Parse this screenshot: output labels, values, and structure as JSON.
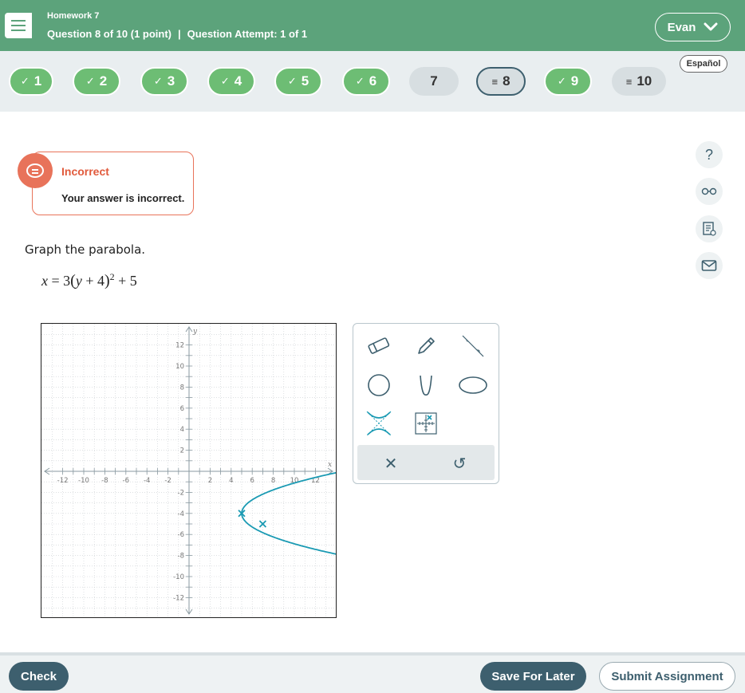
{
  "header": {
    "homework_title": "Homework 7",
    "question_label": "Question 8 of 10 (1 point)",
    "separator": "|",
    "attempt_label": "Question Attempt: 1 of 1",
    "user_name": "Evan",
    "language_link": "Español"
  },
  "question_nav": [
    {
      "number": "1",
      "status": "correct"
    },
    {
      "number": "2",
      "status": "correct"
    },
    {
      "number": "3",
      "status": "correct"
    },
    {
      "number": "4",
      "status": "correct"
    },
    {
      "number": "5",
      "status": "correct"
    },
    {
      "number": "6",
      "status": "correct"
    },
    {
      "number": "7",
      "status": "unanswered"
    },
    {
      "number": "8",
      "status": "partial-current"
    },
    {
      "number": "9",
      "status": "correct"
    },
    {
      "number": "10",
      "status": "partial"
    }
  ],
  "feedback": {
    "title": "Incorrect",
    "message": "Your answer is incorrect."
  },
  "question": {
    "prompt": "Graph the parabola."
  },
  "graph": {
    "x_label": "x",
    "y_label": "y",
    "x_ticks": [
      "-12",
      "-10",
      "-8",
      "-6",
      "-4",
      "-2",
      "2",
      "4",
      "6",
      "8",
      "10",
      "12"
    ],
    "y_ticks": [
      "12",
      "10",
      "8",
      "6",
      "4",
      "2",
      "-2",
      "-4",
      "-6",
      "-8",
      "-10",
      "-12"
    ],
    "range": [
      -13,
      13
    ],
    "curve": {
      "type": "parabola-horizontal",
      "a": 3,
      "k": -4,
      "h": 5
    },
    "points": [
      {
        "x": 5,
        "y": -4
      },
      {
        "x": 7,
        "y": -5
      }
    ],
    "curve_color": "#1a9ab3"
  },
  "tools": {
    "icons": [
      "eraser-icon",
      "pencil-icon",
      "line-icon",
      "circle-icon",
      "parabola-icon",
      "ellipse-icon",
      "hyperbola-icon",
      "point-grid-icon"
    ],
    "clear_glyph": "✕",
    "undo_glyph": "↺"
  },
  "footer": {
    "check_label": "Check",
    "save_label": "Save For Later",
    "submit_label": "Submit Assignment"
  },
  "colors": {
    "header_bg": "#5ca37b",
    "correct_green": "#6dbd74",
    "accent_dark": "#3d5f6e",
    "incorrect_red": "#e8735a"
  }
}
